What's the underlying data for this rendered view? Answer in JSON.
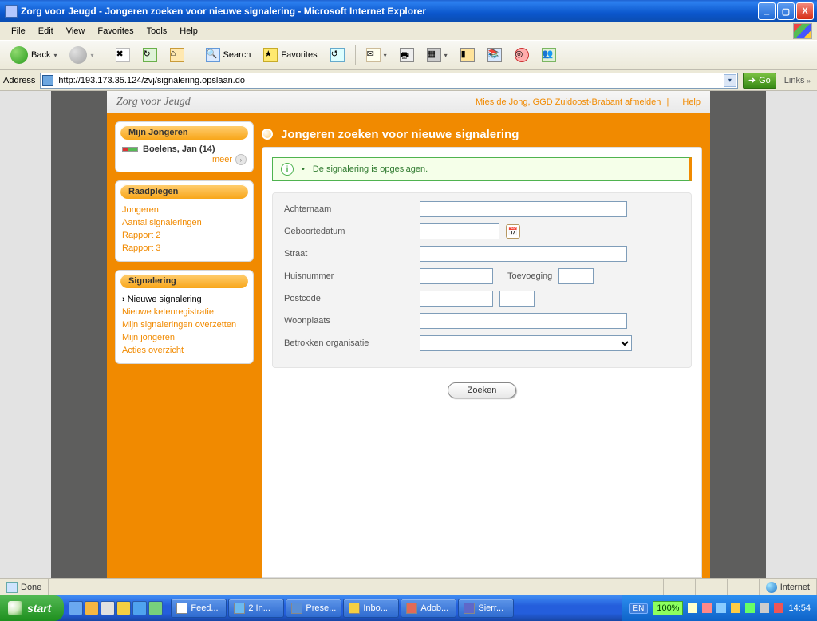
{
  "window": {
    "title": "Zorg voor Jeugd - Jongeren zoeken voor nieuwe signalering - Microsoft Internet Explorer"
  },
  "menubar": [
    "File",
    "Edit",
    "View",
    "Favorites",
    "Tools",
    "Help"
  ],
  "toolbar": {
    "back": "Back",
    "search": "Search",
    "favorites": "Favorites"
  },
  "address": {
    "label": "Address",
    "value": "http://193.173.35.124/zvj/signalering.opslaan.do",
    "go": "Go",
    "links": "Links"
  },
  "header": {
    "brand": "Zorg voor Jeugd",
    "user": "Mies de Jong, GGD Zuidoost-Brabant afmelden",
    "help": "Help"
  },
  "sidebar": {
    "mijn_jongeren": {
      "title": "Mijn Jongeren",
      "item": "Boelens, Jan (14)",
      "meer": "meer"
    },
    "raadplegen": {
      "title": "Raadplegen",
      "items": [
        "Jongeren",
        "Aantal signaleringen",
        "Rapport 2",
        "Rapport 3"
      ]
    },
    "signalering": {
      "title": "Signalering",
      "items": [
        "Nieuwe signalering",
        "Nieuwe ketenregistratie",
        "Mijn signaleringen overzetten",
        "Mijn jongeren",
        "Acties overzicht"
      ]
    }
  },
  "content": {
    "heading": "Jongeren zoeken voor nieuwe signalering",
    "message": "De signalering is opgeslagen.",
    "labels": {
      "achternaam": "Achternaam",
      "geboortedatum": "Geboortedatum",
      "straat": "Straat",
      "huisnummer": "Huisnummer",
      "toevoeging": "Toevoeging",
      "postcode": "Postcode",
      "woonplaats": "Woonplaats",
      "organisatie": "Betrokken organisatie"
    },
    "form": {
      "achternaam": "",
      "geboortedatum": "",
      "straat": "",
      "huisnummer": "",
      "toevoeging": "",
      "postcode1": "",
      "postcode2": "",
      "woonplaats": "",
      "organisatie": ""
    },
    "submit": "Zoeken"
  },
  "statusbar": {
    "left": "Done",
    "zone": "Internet"
  },
  "taskbar": {
    "start": "start",
    "buttons": [
      "Feed...",
      "2 In...",
      "Prese...",
      "Inbo...",
      "Adob...",
      "Sierr..."
    ],
    "lang": "EN",
    "zoom": "100%",
    "clock": "14:54"
  }
}
